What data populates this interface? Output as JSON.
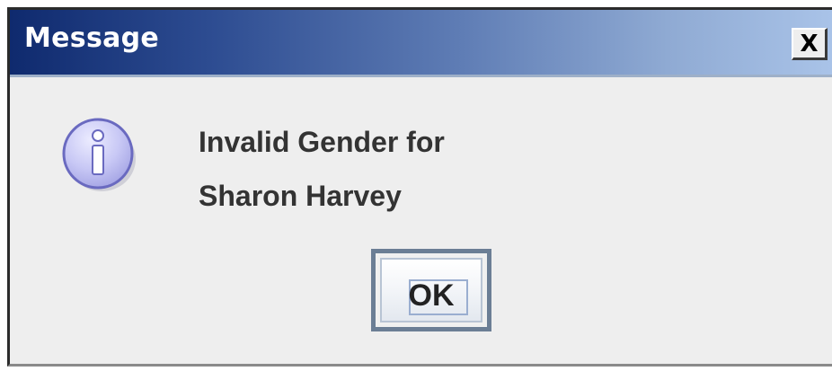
{
  "window": {
    "title": "Message",
    "close_label": "X"
  },
  "message": {
    "line1": "Invalid Gender for",
    "line2": "Sharon Harvey"
  },
  "icon": {
    "name": "information-icon",
    "glyph": "i"
  },
  "buttons": {
    "ok_label": "OK"
  },
  "colors": {
    "title_start": "#0f2a6e",
    "title_end": "#a9c3e8",
    "dialog_bg": "#eeeeee",
    "icon_fill": "#c8c8f5",
    "icon_stroke": "#6a6ac0"
  }
}
